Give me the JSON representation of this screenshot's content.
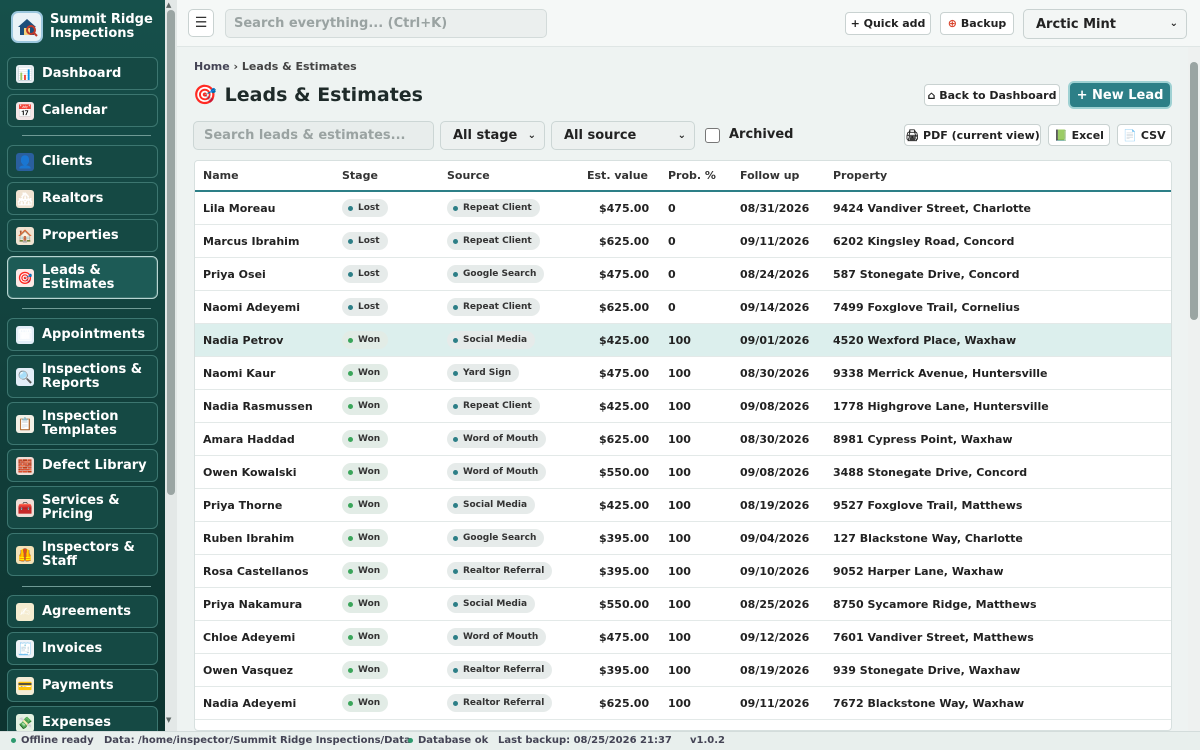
{
  "brand": {
    "name": "Summit Ridge Inspections",
    "logo_icon": "house-magnifier-icon"
  },
  "sidebar": {
    "items": [
      {
        "label": "Dashboard",
        "icon": "📊"
      },
      {
        "label": "Calendar",
        "icon": "📅"
      },
      {
        "label": "Clients",
        "icon": "👤"
      },
      {
        "label": "Realtors",
        "icon": "🏘"
      },
      {
        "label": "Properties",
        "icon": "🏠"
      },
      {
        "label": "Leads & Estimates",
        "icon": "🎯"
      },
      {
        "label": "Appointments",
        "icon": "🗓"
      },
      {
        "label": "Inspections & Reports",
        "icon": "🔍"
      },
      {
        "label": "Inspection Templates",
        "icon": "📋"
      },
      {
        "label": "Defect Library",
        "icon": "🧱"
      },
      {
        "label": "Services & Pricing",
        "icon": "🧰"
      },
      {
        "label": "Inspectors & Staff",
        "icon": "🦺"
      },
      {
        "label": "Agreements",
        "icon": "✍"
      },
      {
        "label": "Invoices",
        "icon": "🧾"
      },
      {
        "label": "Payments",
        "icon": "💳"
      },
      {
        "label": "Expenses",
        "icon": "💸"
      }
    ],
    "active": "Leads & Estimates"
  },
  "topbar": {
    "search_placeholder": "Search everything... (Ctrl+K)",
    "quick_add_label": "+ Quick add",
    "backup_label": "Backup",
    "theme_value": "Arctic Mint"
  },
  "breadcrumb": {
    "home": "Home",
    "separator": "›",
    "current": "Leads & Estimates"
  },
  "page": {
    "title": "Leads & Estimates",
    "title_icon": "🎯",
    "back_label": "⌂ Back to Dashboard",
    "new_label": "+ New Lead"
  },
  "filters": {
    "search_placeholder": "Search leads & estimates...",
    "stage_value": "All stage",
    "source_value": "All source",
    "archived_label": "Archived"
  },
  "export": {
    "pdf_label": "🖨 PDF (current view)",
    "excel_label": "📗 Excel",
    "csv_label": "📄 CSV"
  },
  "table": {
    "columns": [
      "Name",
      "Stage",
      "Source",
      "Est. value",
      "Prob. %",
      "Follow up",
      "Property"
    ],
    "rows": [
      [
        "Lila Moreau",
        "Lost",
        "Repeat Client",
        "$475.00",
        "0",
        "08/31/2026",
        "9424 Vandiver Street, Charlotte"
      ],
      [
        "Marcus Ibrahim",
        "Lost",
        "Repeat Client",
        "$625.00",
        "0",
        "09/11/2026",
        "6202 Kingsley Road, Concord"
      ],
      [
        "Priya Osei",
        "Lost",
        "Google Search",
        "$475.00",
        "0",
        "08/24/2026",
        "587 Stonegate Drive, Concord"
      ],
      [
        "Naomi Adeyemi",
        "Lost",
        "Repeat Client",
        "$625.00",
        "0",
        "09/14/2026",
        "7499 Foxglove Trail, Cornelius"
      ],
      [
        "Nadia Petrov",
        "Won",
        "Social Media",
        "$425.00",
        "100",
        "09/01/2026",
        "4520 Wexford Place, Waxhaw"
      ],
      [
        "Naomi Kaur",
        "Won",
        "Yard Sign",
        "$475.00",
        "100",
        "08/30/2026",
        "9338 Merrick Avenue, Huntersville"
      ],
      [
        "Nadia Rasmussen",
        "Won",
        "Repeat Client",
        "$425.00",
        "100",
        "09/08/2026",
        "1778 Highgrove Lane, Huntersville"
      ],
      [
        "Amara Haddad",
        "Won",
        "Word of Mouth",
        "$625.00",
        "100",
        "08/30/2026",
        "8981 Cypress Point, Waxhaw"
      ],
      [
        "Owen Kowalski",
        "Won",
        "Word of Mouth",
        "$550.00",
        "100",
        "09/08/2026",
        "3488 Stonegate Drive, Concord"
      ],
      [
        "Priya Thorne",
        "Won",
        "Social Media",
        "$425.00",
        "100",
        "08/19/2026",
        "9527 Foxglove Trail, Matthews"
      ],
      [
        "Ruben Ibrahim",
        "Won",
        "Google Search",
        "$395.00",
        "100",
        "09/04/2026",
        "127 Blackstone Way, Charlotte"
      ],
      [
        "Rosa Castellanos",
        "Won",
        "Realtor Referral",
        "$395.00",
        "100",
        "09/10/2026",
        "9052 Harper Lane, Waxhaw"
      ],
      [
        "Priya Nakamura",
        "Won",
        "Social Media",
        "$550.00",
        "100",
        "08/25/2026",
        "8750 Sycamore Ridge, Matthews"
      ],
      [
        "Chloe Adeyemi",
        "Won",
        "Word of Mouth",
        "$475.00",
        "100",
        "09/12/2026",
        "7601 Vandiver Street, Matthews"
      ],
      [
        "Owen Vasquez",
        "Won",
        "Realtor Referral",
        "$395.00",
        "100",
        "08/19/2026",
        "939 Stonegate Drive, Waxhaw"
      ],
      [
        "Nadia Adeyemi",
        "Won",
        "Realtor Referral",
        "$625.00",
        "100",
        "09/11/2026",
        "7672 Blackstone Way, Waxhaw"
      ]
    ],
    "highlighted_row": 4
  },
  "status": {
    "offline": "Offline ready",
    "data_path": "Data: /home/inspector/Summit Ridge Inspections/Data",
    "database": "Database ok",
    "last_backup": "Last backup: 08/25/2026 21:37",
    "version": "v1.0.2"
  },
  "colors": {
    "accent": "#2d7f87",
    "sidebar": "#16504b",
    "won": "#3aa55a"
  }
}
